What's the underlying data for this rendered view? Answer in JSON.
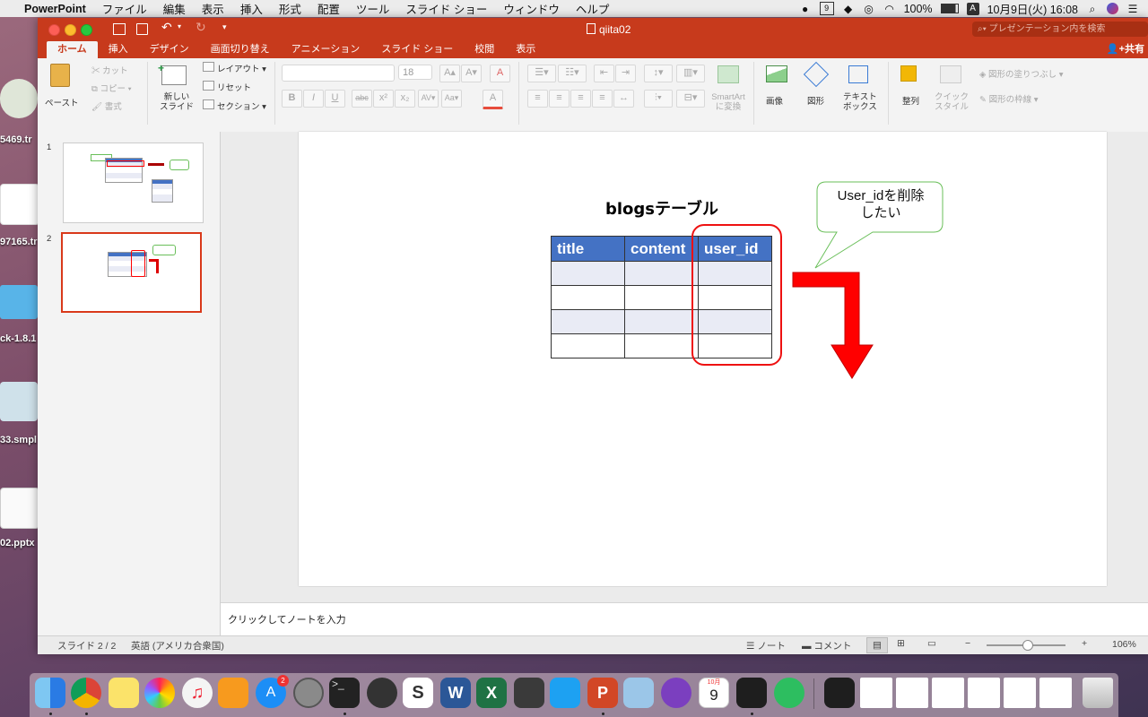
{
  "menubar": {
    "apple": "",
    "app": "PowerPoint",
    "items": [
      "ファイル",
      "編集",
      "表示",
      "挿入",
      "形式",
      "配置",
      "ツール",
      "スライド ショー",
      "ウィンドウ",
      "ヘルプ"
    ],
    "calendar_day": "9",
    "battery": "100%",
    "input_method": "A",
    "datetime": "10月9日(火) 16:08"
  },
  "desktop": {
    "labels": [
      "5469.tr",
      "97165.tr",
      "ck-1.8.1",
      "33.smpl",
      "02.pptx"
    ]
  },
  "window": {
    "title": "qiita02",
    "search_placeholder": "プレゼンテーション内を検索",
    "share_label": "共有",
    "tabs": [
      "ホーム",
      "挿入",
      "デザイン",
      "画面切り替え",
      "アニメーション",
      "スライド ショー",
      "校閲",
      "表示"
    ]
  },
  "ribbon": {
    "paste": "ペースト",
    "cut": "カット",
    "copy": "コピー",
    "format": "書式",
    "new_slide": "新しい\nスライド",
    "new_slide_l1": "新しい",
    "new_slide_l2": "スライド",
    "layout": "レイアウト",
    "reset": "リセット",
    "section": "セクション",
    "font_size": "18",
    "smartart_l1": "SmartArt",
    "smartart_l2": "に変換",
    "picture": "画像",
    "shape": "図形",
    "textbox_l1": "テキスト",
    "textbox_l2": "ボックス",
    "arrange": "整列",
    "quickstyle_l1": "クイック",
    "quickstyle_l2": "スタイル",
    "shape_fill": "図形の塗りつぶし",
    "shape_outline": "図形の枠線"
  },
  "thumbnails": [
    {
      "number": "1",
      "selected": false
    },
    {
      "number": "2",
      "selected": true
    }
  ],
  "slide": {
    "title": "blogsテーブル",
    "table": {
      "headers": [
        "title",
        "content",
        "user_id"
      ],
      "rows": 4
    },
    "callout_line1": "User_idを削除",
    "callout_line2": "したい",
    "colors": {
      "header": "#4472c4",
      "band": "#e9ebf5",
      "highlight": "#ee1111",
      "callout_border": "#6abf5a"
    }
  },
  "notes_placeholder": "クリックしてノートを入力",
  "status": {
    "slide_indicator": "スライド 2 / 2",
    "language": "英語 (アメリカ合衆国)",
    "notes_btn": "ノート",
    "comments_btn": "コメント",
    "zoom": "106%"
  },
  "dock": {
    "calendar_month": "10月",
    "calendar_day": "9",
    "appstore_badge": "2"
  }
}
